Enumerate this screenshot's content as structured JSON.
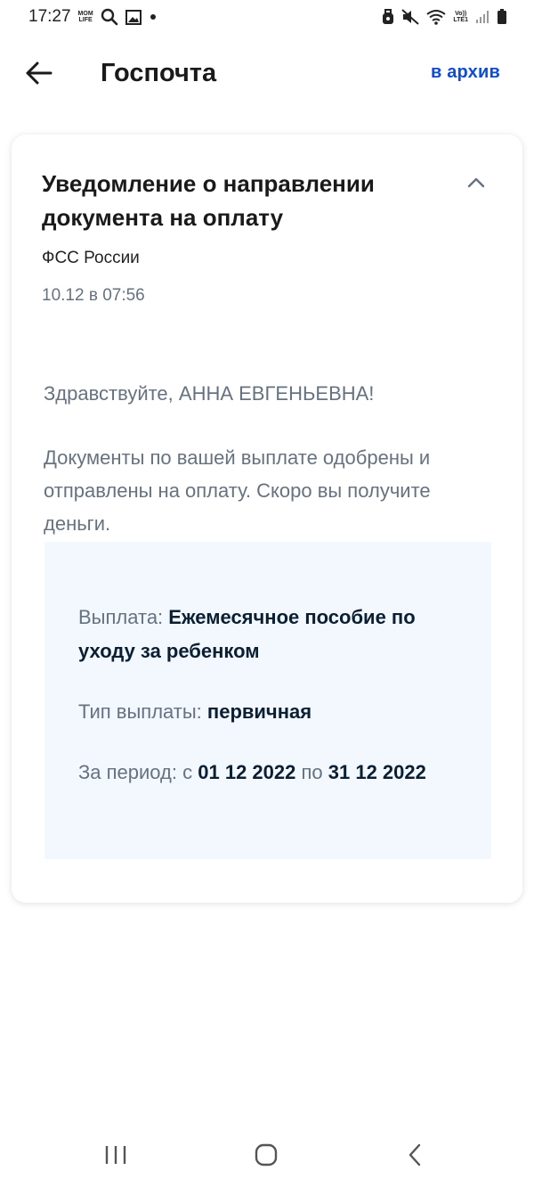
{
  "status_bar": {
    "time": "17:27",
    "notification_icons": [
      "mom-life-icon",
      "search-icon",
      "image-icon",
      "dot-icon"
    ],
    "mom_life_text": [
      "MOM",
      "LIFE"
    ],
    "system_icons": [
      "alarm-icon",
      "mute-icon",
      "wifi-icon",
      "volte-icon",
      "signal-icon",
      "battery-icon"
    ],
    "volte_text": [
      "Vo))",
      "LTE1"
    ]
  },
  "header": {
    "title": "Госпочта",
    "archive_label": "в архив"
  },
  "message": {
    "title": "Уведомление о направлении документа на оплату",
    "sender": "ФСС России",
    "date": "10.12 в 07:56",
    "greeting": "Здравствуйте, АННА ЕВГЕНЬЕВНА!",
    "body": "Документы по вашей выплате одобрены и отправлены на оплату. Скоро вы получите деньги.",
    "details": {
      "payment_label": "Выплата:",
      "payment_value": "Ежемесячное пособие по уходу за ребенком",
      "type_label": "Тип выплаты:",
      "type_value": "первичная",
      "period_label": "За период: с",
      "period_from": "01 12 2022",
      "period_separator": "по",
      "period_to": "31 12 2022"
    }
  },
  "colors": {
    "accent": "#0d4cd3",
    "secondary_text": "#66727f",
    "info_background": "#f3f7fe"
  },
  "nav_bar": {
    "buttons": [
      "recent-apps-icon",
      "home-icon",
      "back-icon"
    ]
  }
}
